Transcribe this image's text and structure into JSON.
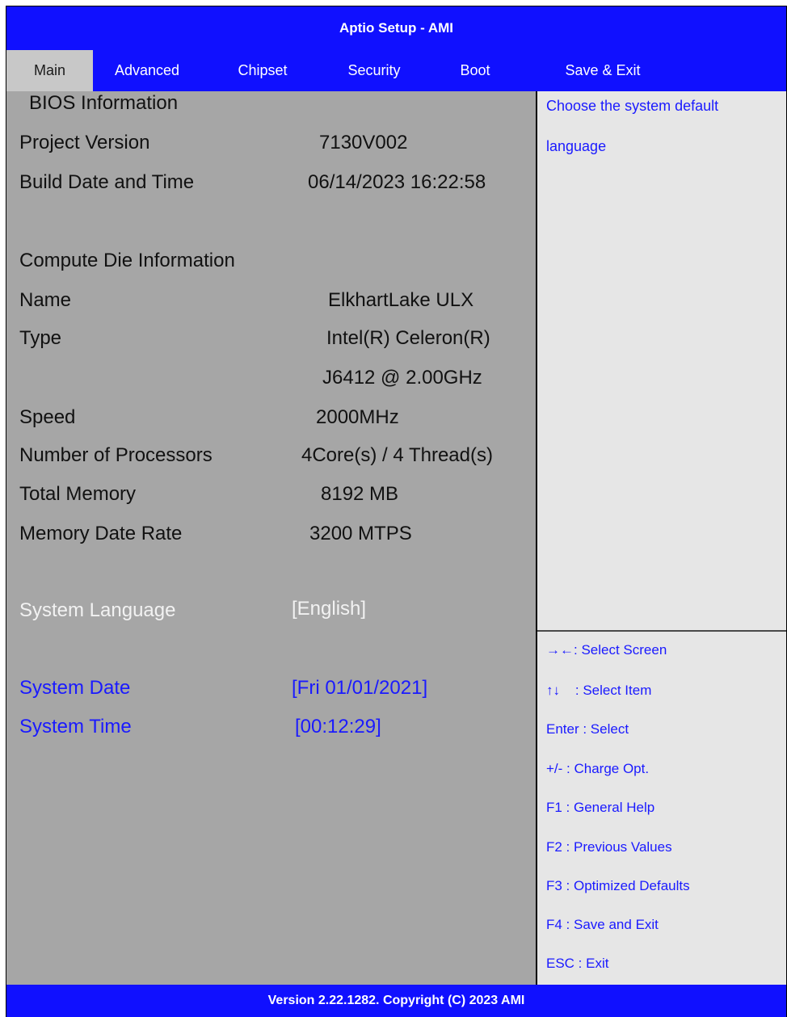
{
  "title": "Aptio Setup - AMI",
  "tabs": [
    {
      "label": "Main",
      "active": true
    },
    {
      "label": "Advanced"
    },
    {
      "label": "Chipset"
    },
    {
      "label": "Security"
    },
    {
      "label": "Boot"
    },
    {
      "label": "Save & Exit"
    }
  ],
  "main": {
    "bios_info": {
      "label": "BIOS Information"
    },
    "project_version": {
      "label": "Project Version",
      "value": "7130V002"
    },
    "build_date": {
      "label": "Build Date and Time",
      "value": "06/14/2023 16:22:58"
    },
    "compute_die": {
      "label": "Compute Die Information"
    },
    "name": {
      "label": "Name",
      "value": "ElkhartLake ULX"
    },
    "type": {
      "label": "Type",
      "value_line1": "Intel(R) Celeron(R)",
      "value_line2": "J6412 @ 2.00GHz"
    },
    "speed": {
      "label": "Speed",
      "value": "2000MHz"
    },
    "processors": {
      "label": "Number of Processors",
      "value": "4Core(s) / 4 Thread(s)"
    },
    "total_memory": {
      "label": "Total Memory",
      "value": "8192 MB"
    },
    "memory_rate": {
      "label": "Memory Date Rate",
      "value": "3200 MTPS"
    },
    "system_language": {
      "label": "System Language",
      "value": "[English]"
    },
    "system_date": {
      "label": "System Date",
      "value": "[Fri 01/01/2021]"
    },
    "system_time": {
      "label": "System Time",
      "value": "[00:12:29]"
    }
  },
  "help": {
    "line1": "Choose the system default",
    "line2": "language"
  },
  "keys": [
    "→←: Select Screen",
    "↑↓    : Select Item",
    "Enter : Select",
    "+/- : Charge Opt.",
    "F1 : General Help",
    "F2 : Previous Values",
    "F3 : Optimized Defaults",
    "F4 : Save and Exit",
    "ESC : Exit"
  ],
  "footer": "Version 2.22.1282. Copyright (C) 2023 AMI",
  "colors": {
    "header_bg": "#1010ff",
    "main_bg": "#a6a6a6",
    "side_bg": "#e6e6e6",
    "selectable_text": "#1a1aff",
    "highlighted_text": "#f2f2f2"
  }
}
